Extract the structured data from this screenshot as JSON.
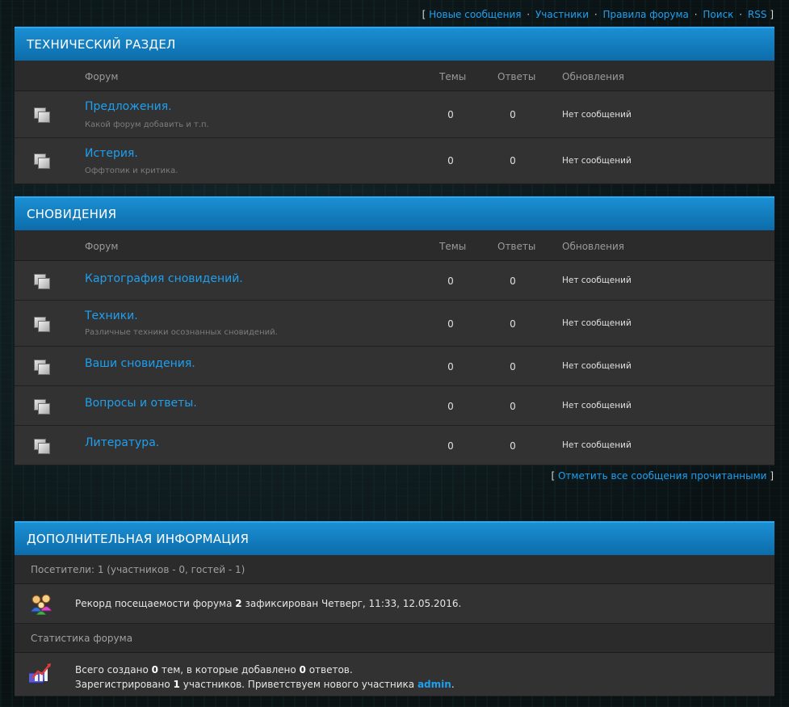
{
  "topnav": {
    "open": "[",
    "close": "]",
    "links": [
      "Новые сообщения",
      "Участники",
      "Правила форума",
      "Поиск",
      "RSS"
    ],
    "separator": "·"
  },
  "columns": {
    "forum": "Форум",
    "topics": "Темы",
    "replies": "Ответы",
    "updates": "Обновления"
  },
  "categories": [
    {
      "title": "ТЕХНИЧЕСКИЙ РАЗДЕЛ",
      "forums": [
        {
          "name": "Предложения.",
          "desc": "Какой форум добавить и т.п.",
          "topics": "0",
          "replies": "0",
          "updates": "Нет сообщений"
        },
        {
          "name": "Истерия.",
          "desc": "Оффтопик и критика.",
          "topics": "0",
          "replies": "0",
          "updates": "Нет сообщений"
        }
      ]
    },
    {
      "title": "СНОВИДЕНИЯ",
      "forums": [
        {
          "name": "Картография сновидений.",
          "desc": "",
          "topics": "0",
          "replies": "0",
          "updates": "Нет сообщений"
        },
        {
          "name": "Техники.",
          "desc": "Различные техники осознанных сновидений.",
          "topics": "0",
          "replies": "0",
          "updates": "Нет сообщений"
        },
        {
          "name": "Ваши сновидения.",
          "desc": "",
          "topics": "0",
          "replies": "0",
          "updates": "Нет сообщений"
        },
        {
          "name": "Вопросы и ответы.",
          "desc": "",
          "topics": "0",
          "replies": "0",
          "updates": "Нет сообщений"
        },
        {
          "name": "Литература.",
          "desc": "",
          "topics": "0",
          "replies": "0",
          "updates": "Нет сообщений"
        }
      ]
    }
  ],
  "markread": {
    "open": "[",
    "close": "]",
    "label": "Отметить все сообщения прочитанными"
  },
  "info": {
    "title": "ДОПОЛНИТЕЛЬНАЯ ИНФОРМАЦИЯ",
    "visitors": "Посетители: 1  (участников - 0, гостей - 1)",
    "record": {
      "prefix": "Рекорд посещаемости форума ",
      "count": "2",
      "suffix": " зафиксирован Четверг, 11:33, 12.05.2016."
    },
    "stats_title": "Статистика форума",
    "stats": {
      "p1": "Всего создано ",
      "topics": "0",
      "p2": " тем, в которые добавлено ",
      "replies": "0",
      "p3": " ответов.",
      "p4": "Зарегистрировано ",
      "members": "1",
      "p5": " участников. Приветствуем нового участника ",
      "newest": "admin",
      "p6": "."
    }
  },
  "colors": {
    "accent": "#1ea0ef",
    "header_blue": "#0d6cab",
    "row_bg": "#323232"
  }
}
